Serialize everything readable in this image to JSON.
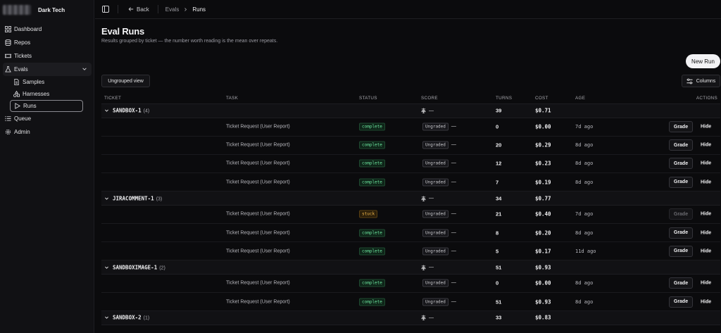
{
  "brand": {
    "name": "Dark Tech"
  },
  "sidebar": {
    "items": [
      {
        "label": "Dashboard",
        "icon": "grid-icon"
      },
      {
        "label": "Repos",
        "icon": "database-icon"
      },
      {
        "label": "Tickets",
        "icon": "ticket-icon"
      },
      {
        "label": "Evals",
        "icon": "flask-icon",
        "expanded": true
      },
      {
        "label": "Queue",
        "icon": "list-icon"
      },
      {
        "label": "Admin",
        "icon": "gear-icon"
      }
    ],
    "sub_items": [
      {
        "label": "Samples",
        "icon": "document-icon"
      },
      {
        "label": "Harnesses",
        "icon": "shapes-icon"
      },
      {
        "label": "Runs",
        "icon": "play-icon",
        "active": true
      }
    ]
  },
  "topbar": {
    "back_label": "Back",
    "crumb_parent": "Evals",
    "crumb_current": "Runs"
  },
  "page": {
    "title": "Eval Runs",
    "subtitle": "Results grouped by ticket — the number worth reading is the mean over repeats.",
    "new_run_label": "New Run",
    "ungrouped_label": "Ungrouped view",
    "columns_label": "Columns"
  },
  "table": {
    "headers": {
      "ticket": "TICKET",
      "task": "TASK",
      "status": "STATUS",
      "score": "SCORE",
      "turns": "TURNS",
      "cost": "COST",
      "age": "AGE",
      "actions": "ACTIONS"
    },
    "grade_label": "Grade",
    "hide_label": "Hide",
    "ungraded_label": "Ungraded",
    "dash": "—",
    "groups": [
      {
        "name": "SANDBOX-1",
        "count": "(4)",
        "turns": "39",
        "cost": "$0.71",
        "runs": [
          {
            "task": "Ticket Request (User Report)",
            "status": "complete",
            "turns": "0",
            "cost": "$0.00",
            "age": "7d ago"
          },
          {
            "task": "Ticket Request (User Report)",
            "status": "complete",
            "turns": "20",
            "cost": "$0.29",
            "age": "8d ago"
          },
          {
            "task": "Ticket Request (User Report)",
            "status": "complete",
            "turns": "12",
            "cost": "$0.23",
            "age": "8d ago"
          },
          {
            "task": "Ticket Request (User Report)",
            "status": "complete",
            "turns": "7",
            "cost": "$0.19",
            "age": "8d ago"
          }
        ]
      },
      {
        "name": "JIRACOMMENT-1",
        "count": "(3)",
        "turns": "34",
        "cost": "$0.77",
        "runs": [
          {
            "task": "Ticket Request (User Report)",
            "status": "stuck",
            "turns": "21",
            "cost": "$0.40",
            "age": "7d ago",
            "grade_disabled": true
          },
          {
            "task": "Ticket Request (User Report)",
            "status": "complete",
            "turns": "8",
            "cost": "$0.20",
            "age": "8d ago"
          },
          {
            "task": "Ticket Request (User Report)",
            "status": "complete",
            "turns": "5",
            "cost": "$0.17",
            "age": "11d ago"
          }
        ]
      },
      {
        "name": "SANDBOXIMAGE-1",
        "count": "(2)",
        "turns": "51",
        "cost": "$0.93",
        "runs": [
          {
            "task": "Ticket Request (User Report)",
            "status": "complete",
            "turns": "0",
            "cost": "$0.00",
            "age": "8d ago"
          },
          {
            "task": "Ticket Request (User Report)",
            "status": "complete",
            "turns": "51",
            "cost": "$0.93",
            "age": "8d ago"
          }
        ]
      },
      {
        "name": "SANDBOX-2",
        "count": "(1)",
        "turns": "33",
        "cost": "$0.83",
        "runs": []
      }
    ]
  }
}
